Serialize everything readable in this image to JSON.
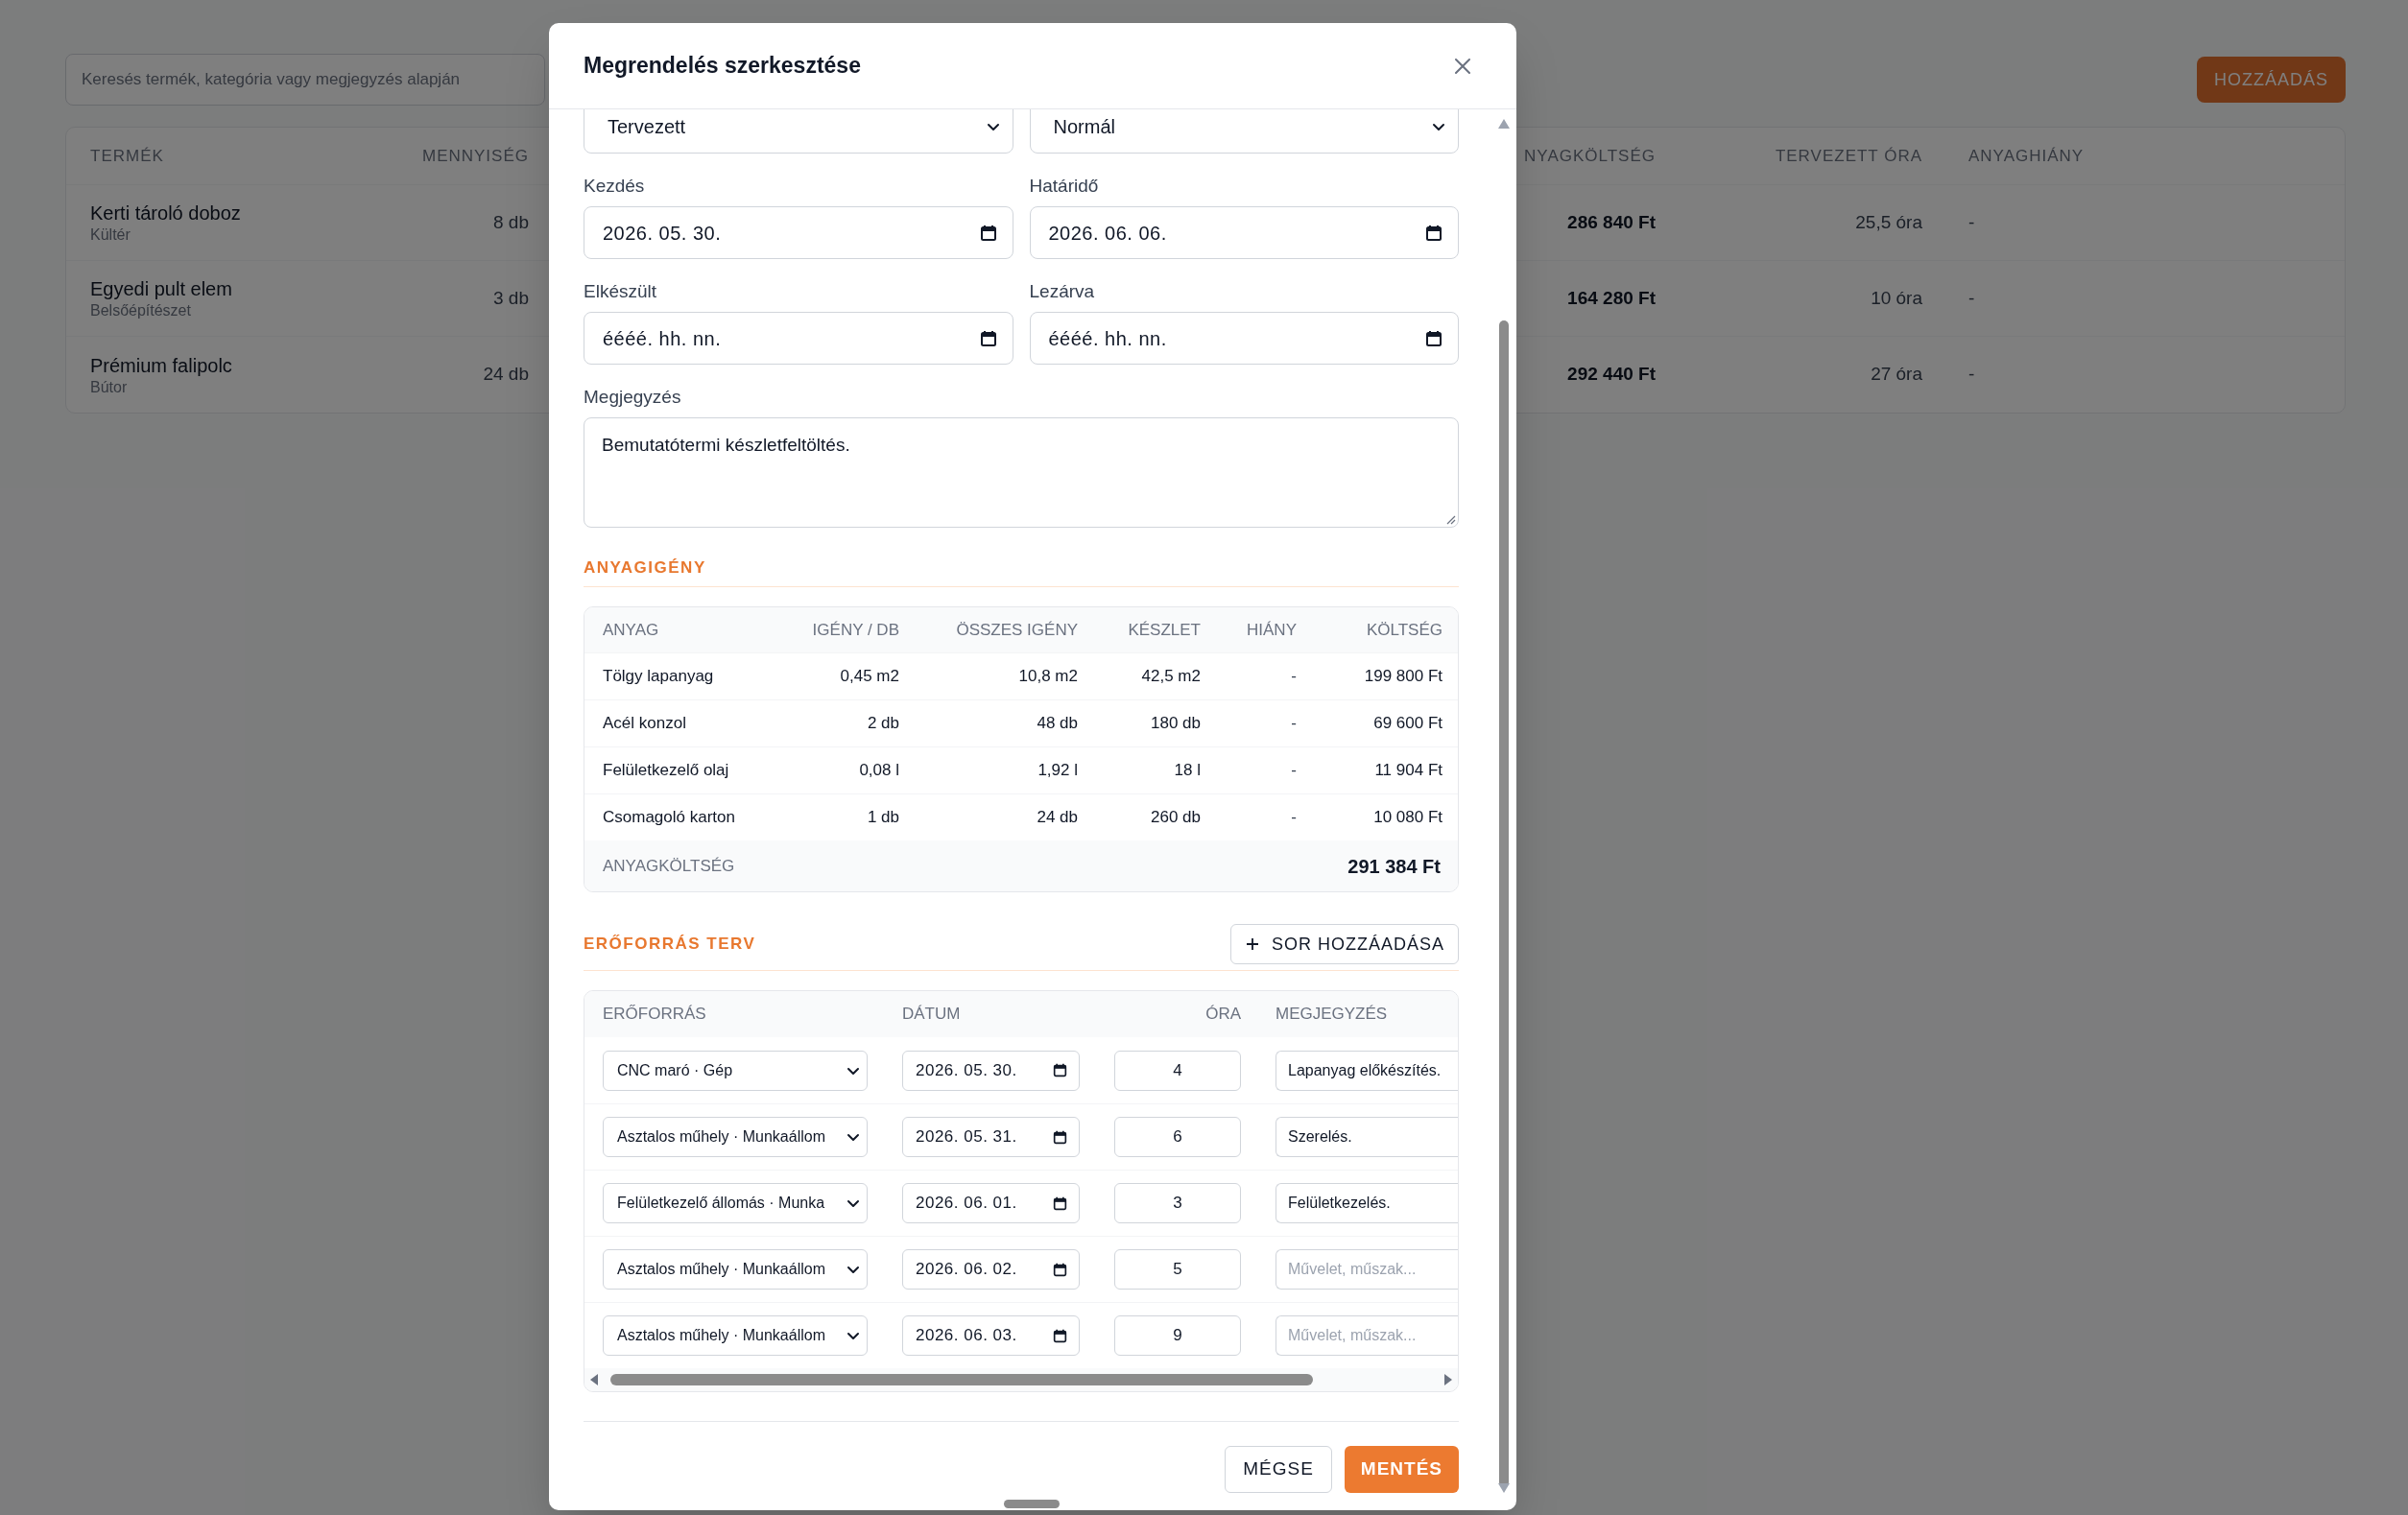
{
  "page": {
    "search": {
      "placeholder": "Keresés termék, kategória vagy megjegyzés alapján"
    },
    "add_button": "HOZZÁADÁS",
    "table": {
      "columns": [
        "TERMÉK",
        "MENNYISÉG",
        "NYAGKÖLTSÉG",
        "TERVEZETT ÓRA",
        "ANYAGHIÁNY"
      ],
      "rows": [
        {
          "product": "Kerti tároló doboz",
          "category": "Kültér",
          "quantity": "8 db",
          "material_cost": "286 840 Ft",
          "planned_hours": "25,5 óra",
          "shortage": "-"
        },
        {
          "product": "Egyedi pult elem",
          "category": "Belsőépítészet",
          "quantity": "3 db",
          "material_cost": "164 280 Ft",
          "planned_hours": "10 óra",
          "shortage": "-"
        },
        {
          "product": "Prémium falipolc",
          "category": "Bútor",
          "quantity": "24 db",
          "material_cost": "292 440 Ft",
          "planned_hours": "27 óra",
          "shortage": "-"
        }
      ]
    }
  },
  "modal": {
    "title": "Megrendelés szerkesztése",
    "selects": [
      "Tervezett",
      "Normál"
    ],
    "date_fields": [
      {
        "label": "Kezdés",
        "value": "2026. 05. 30."
      },
      {
        "label": "Határidő",
        "value": "2026. 06. 06."
      },
      {
        "label": "Elkészült",
        "value": "éééé. hh. nn."
      },
      {
        "label": "Lezárva",
        "value": "éééé. hh. nn."
      }
    ],
    "note": {
      "label": "Megjegyzés",
      "value": "Bemutatótermi készletfeltöltés."
    },
    "materials": {
      "title": "ANYAGIGÉNY",
      "columns": [
        "ANYAG",
        "IGÉNY / DB",
        "ÖSSZES IGÉNY",
        "KÉSZLET",
        "HIÁNY",
        "KÖLTSÉG"
      ],
      "rows": [
        [
          "Tölgy lapanyag",
          "0,45 m2",
          "10,8 m2",
          "42,5 m2",
          "-",
          "199 800 Ft"
        ],
        [
          "Acél konzol",
          "2 db",
          "48 db",
          "180 db",
          "-",
          "69 600 Ft"
        ],
        [
          "Felületkezelő olaj",
          "0,08 l",
          "1,92 l",
          "18 l",
          "-",
          "11 904 Ft"
        ],
        [
          "Csomagoló karton",
          "1 db",
          "24 db",
          "260 db",
          "-",
          "10 080 Ft"
        ]
      ],
      "total_label": "ANYAGKÖLTSÉG",
      "total_value": "291 384 Ft"
    },
    "resources": {
      "title": "ERŐFORRÁS TERV",
      "add_row_button": "SOR HOZZÁADÁSA",
      "columns": [
        "ERŐFORRÁS",
        "DÁTUM",
        "ÓRA",
        "MEGJEGYZÉS"
      ],
      "rows": [
        {
          "resource": "CNC maró · Gép",
          "date": "2026. 05. 30.",
          "hours": "4",
          "note": "Lapanyag előkészítés."
        },
        {
          "resource": "Asztalos műhely · Munkaállom",
          "date": "2026. 05. 31.",
          "hours": "6",
          "note": "Szerelés."
        },
        {
          "resource": "Felületkezelő állomás · Munka",
          "date": "2026. 06. 01.",
          "hours": "3",
          "note": "Felületkezelés."
        },
        {
          "resource": "Asztalos műhely · Munkaállom",
          "date": "2026. 06. 02.",
          "hours": "5",
          "placeholder": "Művelet, műszak..."
        },
        {
          "resource": "Asztalos műhely · Munkaállom",
          "date": "2026. 06. 03.",
          "hours": "9",
          "placeholder": "Művelet, műszak..."
        }
      ]
    },
    "buttons": {
      "cancel": "MÉGSE",
      "save": "MENTÉS"
    }
  }
}
